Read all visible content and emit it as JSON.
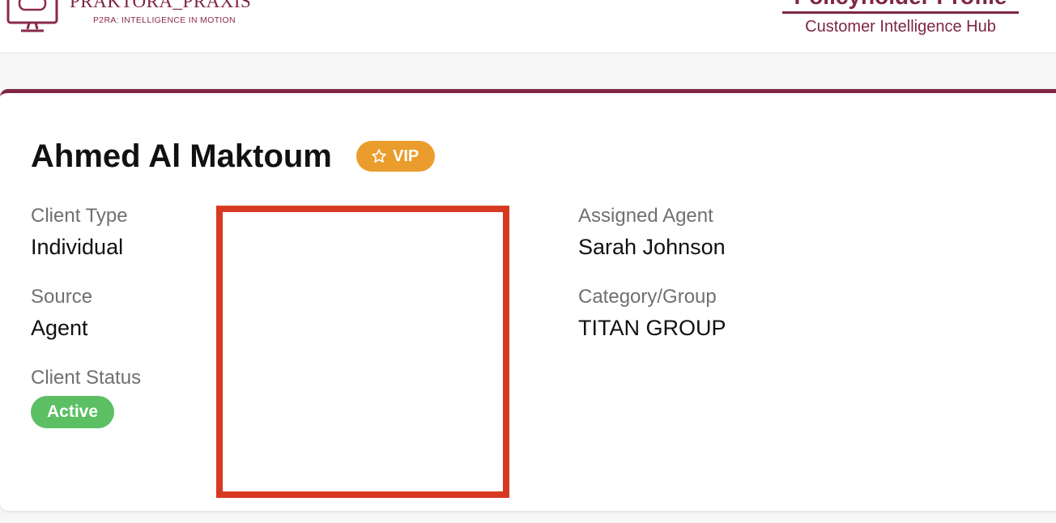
{
  "header": {
    "brand_name": "PRAKTORA_PRAXIS",
    "brand_tagline": "P2RA: INTELLIGENCE IN MOTION",
    "page_title": "Policyholder Profile",
    "page_subtitle": "Customer Intelligence Hub",
    "brand_color": "#7d2645"
  },
  "profile": {
    "client_name": "Ahmed Al Maktoum",
    "vip_badge": {
      "label": "VIP",
      "icon": "star-icon",
      "color": "#ea9d2c"
    },
    "fields": {
      "client_type": {
        "label": "Client Type",
        "value": "Individual"
      },
      "source": {
        "label": "Source",
        "value": "Agent"
      },
      "client_status": {
        "label": "Client Status",
        "value": "Active",
        "color": "#5cbf63"
      },
      "assigned_agent": {
        "label": "Assigned Agent",
        "value": "Sarah Johnson"
      },
      "category_group": {
        "label": "Category/Group",
        "value": "TITAN GROUP"
      }
    },
    "redaction_color": "#d63b22"
  }
}
